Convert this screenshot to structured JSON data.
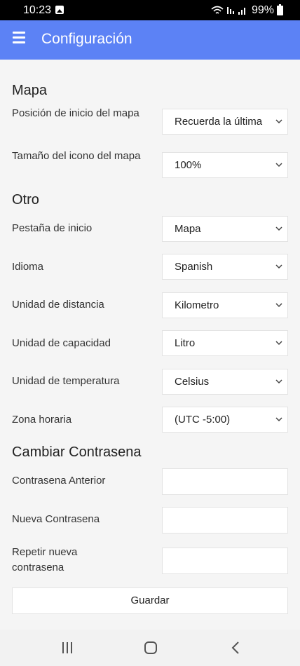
{
  "status_bar": {
    "time": "10:23",
    "battery_level": "99%"
  },
  "app_bar": {
    "title": "Configuración"
  },
  "sections": {
    "map": {
      "title": "Mapa",
      "start_position_label": "Posición de inicio del mapa",
      "start_position_value": "Recuerda la última",
      "icon_size_label": "Tamaño del icono del mapa",
      "icon_size_value": "100%"
    },
    "other": {
      "title": "Otro",
      "start_tab_label": "Pestaña de inicio",
      "start_tab_value": "Mapa",
      "language_label": "Idioma",
      "language_value": "Spanish",
      "distance_unit_label": "Unidad de distancia",
      "distance_unit_value": "Kilometro",
      "capacity_unit_label": "Unidad de capacidad",
      "capacity_unit_value": "Litro",
      "temperature_unit_label": "Unidad de temperatura",
      "temperature_unit_value": "Celsius",
      "timezone_label": "Zona horaria",
      "timezone_value": "(UTC -5:00)"
    },
    "password": {
      "title": "Cambiar Contrasena",
      "old_password_label": "Contrasena Anterior",
      "new_password_label": "Nueva Contrasena",
      "repeat_password_label": "Repetir nueva contrasena"
    }
  },
  "save_button_label": "Guardar",
  "colors": {
    "app_bar": "#5c82f5",
    "background": "#f5f5f5",
    "field_background": "#ffffff"
  },
  "icons": {
    "menu": "hamburger-menu-icon",
    "select": "chevron-down-icon",
    "nav_recents": "recents-icon",
    "nav_home": "home-icon",
    "nav_back": "back-icon"
  }
}
